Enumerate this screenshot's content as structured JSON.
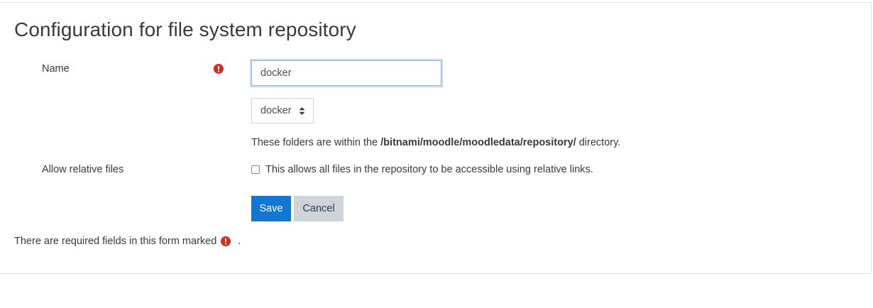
{
  "page": {
    "title": "Configuration for file system repository"
  },
  "form": {
    "name_label": "Name",
    "name_value": "docker",
    "folder_select_value": "docker",
    "help_prefix": "These folders are within the ",
    "help_path": "/bitnami/moodle/moodledata/repository/",
    "help_suffix": " directory.",
    "relative_label": "Allow relative files",
    "relative_checkbox_text": "This allows all files in the repository to be accessible using relative links.",
    "relative_checked": false
  },
  "buttons": {
    "save_label": "Save",
    "cancel_label": "Cancel"
  },
  "footer": {
    "required_note": "There are required fields in this form marked",
    "required_note_end": "."
  },
  "colors": {
    "required_icon": "#ca3120",
    "primary_button": "#1177d1",
    "secondary_button": "#ced4da"
  },
  "icons": {
    "required": "exclamation-circle-icon",
    "select_arrow": "sort-arrows-icon"
  }
}
